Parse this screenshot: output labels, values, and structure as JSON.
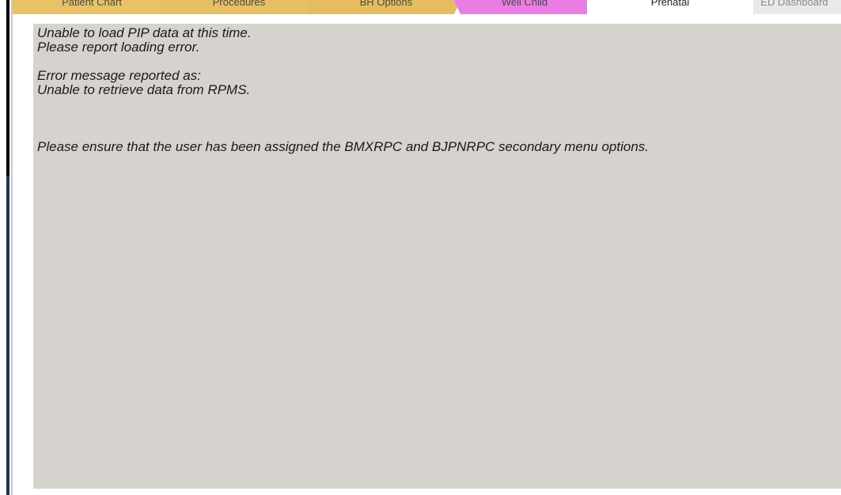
{
  "tabs": [
    {
      "label": "Patient Chart"
    },
    {
      "label": "Procedures"
    },
    {
      "label": "BH Options"
    },
    {
      "label": "Well Child"
    },
    {
      "label": "Prenatal"
    },
    {
      "label": "ED Dashboard"
    }
  ],
  "error_panel": {
    "line1": "Unable to load PIP data at this time.",
    "line2": "Please report loading error.",
    "line3": "Error message reported as:",
    "line4": "Unable to retrieve data from RPMS.",
    "line5": "Please ensure that the user has been assigned the BMXRPC and BJPNRPC secondary menu options."
  },
  "colors": {
    "panel_bg": "#d6d3ce",
    "tab_gold": "#e6c063",
    "tab_pink": "#e97de3",
    "tab_active": "#ffffff"
  }
}
